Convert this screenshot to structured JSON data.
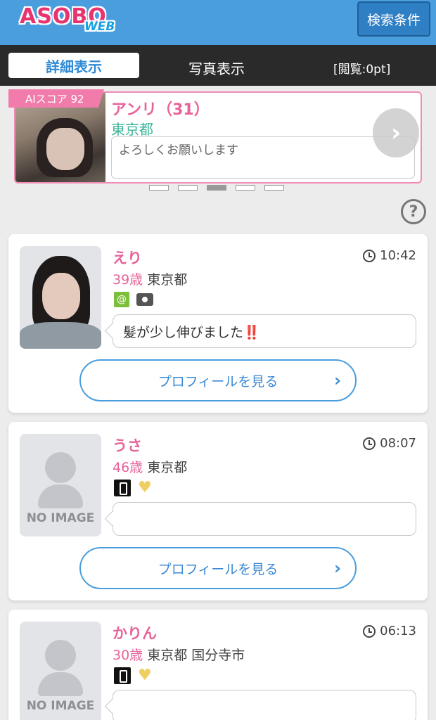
{
  "header": {
    "logo_main": "ASOBO",
    "logo_sub": "WEB",
    "search_button": "検索条件"
  },
  "tabs": {
    "detail": "詳細表示",
    "photo": "写真表示",
    "points": "[閲覧:0pt]"
  },
  "featured": {
    "ai_score": "AIスコア 92",
    "name": "アンリ（31）",
    "area": "東京都",
    "message": "よろしくお願いします",
    "next_icon": "chevron-right-icon",
    "dots_count": 5,
    "active_dot": 3
  },
  "help_icon": "?",
  "users": [
    {
      "name": "えり",
      "time": "10:42",
      "age": "39歳",
      "area": "東京都",
      "has_photo": true,
      "message_text": "髪が少し伸びました",
      "message_emoji": "‼️",
      "profile_button": "プロフィールを見る"
    },
    {
      "name": "うさ",
      "time": "08:07",
      "age": "46歳",
      "area": "東京都",
      "has_photo": false,
      "no_image_label": "NO IMAGE",
      "message_text": "",
      "message_emoji": "",
      "profile_button": "プロフィールを見る"
    },
    {
      "name": "かりん",
      "time": "06:13",
      "age": "30歳",
      "area": "東京都 国分寺市",
      "has_photo": false,
      "no_image_label": "NO IMAGE",
      "message_text": "",
      "message_emoji": ""
    }
  ]
}
